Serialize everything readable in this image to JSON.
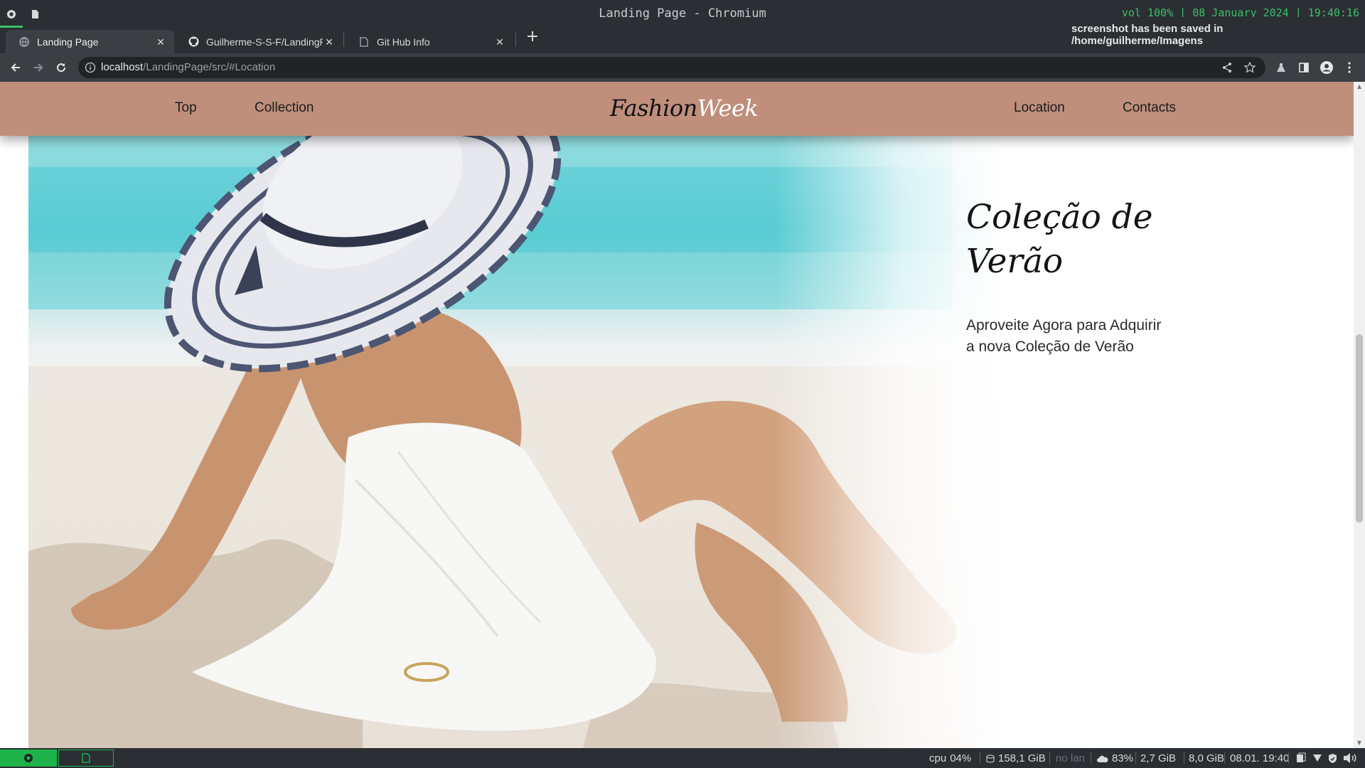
{
  "window": {
    "title": "Landing Page - Chromium",
    "sysinfo": "vol 100% | 08 January 2024 | 19:40:16"
  },
  "notification": {
    "text": "screenshot has been saved in /home/guilherme/Imagens"
  },
  "tabs": [
    {
      "title": "Landing Page",
      "icon": "globe-icon",
      "active": true
    },
    {
      "title": "Guilherme-S-S-F/LandingPag",
      "icon": "github-icon",
      "active": false
    },
    {
      "title": "Git Hub Info",
      "icon": "document-icon",
      "active": false
    }
  ],
  "address": {
    "host": "localhost",
    "path": "/LandingPage/src/#Location"
  },
  "site": {
    "nav_left": [
      "Top",
      "Collection"
    ],
    "brand_part1": "Fashion",
    "brand_part2": "Week",
    "nav_right": [
      "Location",
      "Contacts"
    ],
    "hero_title_line1": "Coleção de",
    "hero_title_line2": "Verão",
    "hero_subtitle_line1": "Aproveite Agora para Adquirir",
    "hero_subtitle_line2": "a nova Coleção de Verão"
  },
  "statusbar": {
    "cpu_label": "cpu",
    "cpu_value": "04%",
    "disk": "158,1 GiB",
    "network": "no lan",
    "battery": "83%",
    "mem_used": "2,7 GiB",
    "mem_total": "8,0 GiB",
    "datetime": "08.01. 19:40"
  },
  "colors": {
    "header_bg": "#bf8f7c",
    "accent_green": "#1db34a",
    "chrome_dark": "#2b2f33"
  }
}
